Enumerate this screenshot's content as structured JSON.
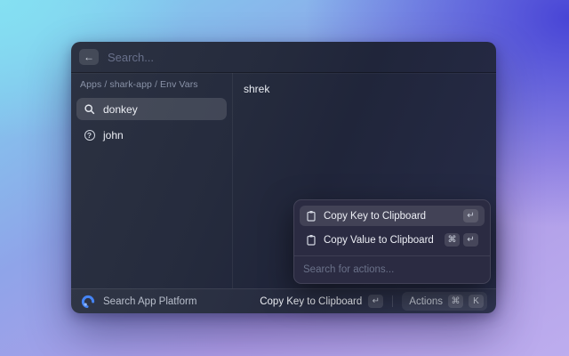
{
  "window": {
    "header": {
      "back_glyph": "←",
      "search_placeholder": "Search..."
    },
    "sidebar": {
      "breadcrumb": "Apps / shark-app / Env Vars",
      "items": [
        {
          "label": "donkey",
          "icon": "magnifier-icon",
          "selected": true
        },
        {
          "label": "john",
          "icon": "question-circle-icon",
          "selected": false
        }
      ]
    },
    "detail": {
      "value": "shrek"
    },
    "action_panel": {
      "items": [
        {
          "label": "Copy Key to Clipboard",
          "icon": "clipboard-icon",
          "keys": [
            "↵"
          ],
          "selected": true
        },
        {
          "label": "Copy Value to Clipboard",
          "icon": "clipboard-icon",
          "keys": [
            "⌘",
            "↵"
          ],
          "selected": false
        }
      ],
      "search_placeholder": "Search for actions..."
    },
    "footer": {
      "app_name": "Search App Platform",
      "primary_action": {
        "label": "Copy Key to Clipboard",
        "keys": [
          "↵"
        ]
      },
      "actions_button": {
        "label": "Actions",
        "keys": [
          "⌘",
          "K"
        ]
      }
    }
  },
  "colors": {
    "logo_blue": "#4584f4",
    "selection": "rgba(255,255,255,0.13)"
  }
}
